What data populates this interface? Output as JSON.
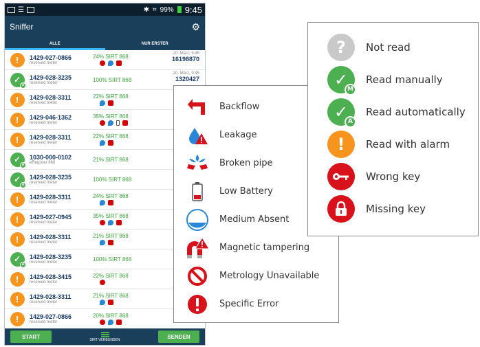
{
  "status_bar": {
    "battery": "99%",
    "time": "9:45"
  },
  "app": {
    "title": "Sniffer"
  },
  "tabs": [
    {
      "label": "ALLE"
    },
    {
      "label": "NUR ERSTER"
    }
  ],
  "rows": [
    {
      "num": "1429-027-0866",
      "sub": "reserved meter",
      "sig": "24% SIRT 868",
      "date": "20. März, 9:45",
      "val": "16198870"
    },
    {
      "num": "1429-028-3235",
      "sub": "reserved meter",
      "sig": "100% SIRT 868",
      "date": "20. März, 9:45",
      "val": "1320427"
    },
    {
      "num": "1429-028-3311",
      "sub": "reserved meter",
      "sig": "22% SIRT 868"
    },
    {
      "num": "1429-046-1362",
      "sub": "reserved meter",
      "sig": "35% SIRT 868"
    },
    {
      "num": "1429-028-3311",
      "sub": "reserved meter",
      "sig": "22% SIRT 868"
    },
    {
      "num": "1030-000-0102",
      "sub": "eRegister 868",
      "sig": "21% SIRT 868"
    },
    {
      "num": "1429-028-3235",
      "sub": "reserved meter",
      "sig": "100% SIRT 868"
    },
    {
      "num": "1429-028-3311",
      "sub": "reserved meter",
      "sig": "24% SIRT 868"
    },
    {
      "num": "1429-027-0945",
      "sub": "reserved meter",
      "sig": "35% SIRT 868"
    },
    {
      "num": "1429-028-3311",
      "sub": "reserved meter",
      "sig": "21% SIRT 868"
    },
    {
      "num": "1429-028-3235",
      "sub": "reserved meter",
      "sig": "100% SIRT 868"
    },
    {
      "num": "1429-028-3415",
      "sub": "reserved meter",
      "sig": "22% SIRT 868"
    },
    {
      "num": "1429-028-3311",
      "sub": "reserved meter",
      "sig": "21% SIRT 868"
    },
    {
      "num": "1429-027-0866",
      "sub": "reserved meter",
      "sig": "20% SIRT 868"
    }
  ],
  "bottom": {
    "start": "START",
    "status": "SIRT VERBUNDEN",
    "send": "SENDEN"
  },
  "icon_legend": [
    {
      "label": "Backflow",
      "icon": "backflow-icon"
    },
    {
      "label": "Leakage",
      "icon": "leakage-icon"
    },
    {
      "label": "Broken pipe",
      "icon": "broken-pipe-icon"
    },
    {
      "label": "Low Battery",
      "icon": "low-battery-icon"
    },
    {
      "label": "Medium Absent",
      "icon": "medium-absent-icon"
    },
    {
      "label": "Magnetic tampering",
      "icon": "magnetic-tampering-icon"
    },
    {
      "label": "Metrology Unavailable",
      "icon": "metrology-unavailable-icon"
    },
    {
      "label": "Specific Error",
      "icon": "specific-error-icon"
    }
  ],
  "status_legend": [
    {
      "label": "Not read",
      "icon": "not-read-icon"
    },
    {
      "label": "Read manually",
      "icon": "read-manually-icon",
      "badge": "M"
    },
    {
      "label": "Read automatically",
      "icon": "read-automatically-icon",
      "badge": "A"
    },
    {
      "label": "Read with alarm",
      "icon": "read-with-alarm-icon"
    },
    {
      "label": "Wrong key",
      "icon": "wrong-key-icon"
    },
    {
      "label": "Missing key",
      "icon": "missing-key-icon"
    }
  ],
  "colors": {
    "appbar": "#1a3f5a",
    "alarm": "#f7941d",
    "ok": "#4caf50",
    "error": "#d8111a"
  }
}
